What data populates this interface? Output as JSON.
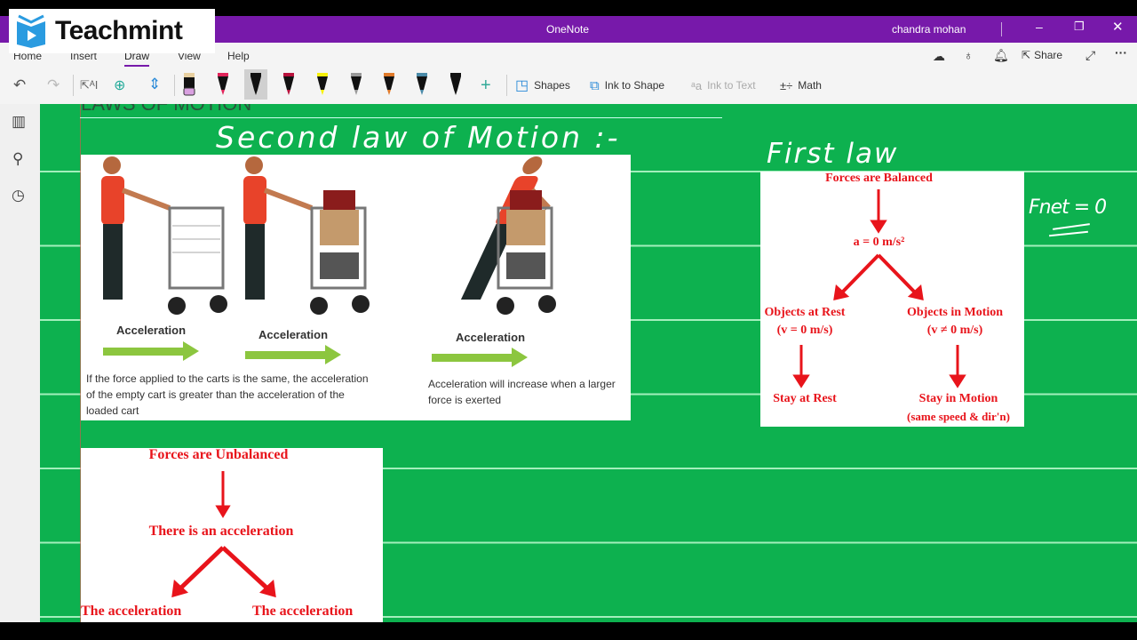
{
  "logo": {
    "text": "Teachmint"
  },
  "titlebar": {
    "app": "OneNote",
    "user": "chandra mohan"
  },
  "ribbon": {
    "tabs": [
      "Home",
      "Insert",
      "Draw",
      "View",
      "Help"
    ],
    "active_tab": "Draw",
    "share": "Share",
    "tools": {
      "shapes": "Shapes",
      "ink_to_shape": "Ink to Shape",
      "ink_to_text": "Ink to Text",
      "math": "Math"
    },
    "pens": [
      {
        "name": "eraser",
        "colors": [
          "#111111",
          "#d9a0e0"
        ]
      },
      {
        "name": "pen-pink",
        "colors": [
          "#e0245a",
          "#111111"
        ]
      },
      {
        "name": "pen-black-selected",
        "colors": [
          "#111111",
          "#ffffff"
        ]
      },
      {
        "name": "pen-crimson",
        "colors": [
          "#b8123c",
          "#111111"
        ]
      },
      {
        "name": "highlighter-yellow",
        "colors": [
          "#f7f00a",
          "#111111"
        ]
      },
      {
        "name": "pencil-gray",
        "colors": [
          "#999999",
          "#111111"
        ]
      },
      {
        "name": "pen-rainbow",
        "colors": [
          "#e07a2a",
          "#111111"
        ]
      },
      {
        "name": "pen-blue-gray",
        "colors": [
          "#4a8aa8",
          "#111111"
        ]
      },
      {
        "name": "pen-black",
        "colors": [
          "#111111",
          "#111111"
        ]
      }
    ]
  },
  "page": {
    "title": "LAWS OF MOTION",
    "handwriting": {
      "second_law": "Second law of Motion :-",
      "first_law": "First law",
      "fnet": "Fnet = 0"
    },
    "image_panel": {
      "label": "Acceleration",
      "caption_left": "If the force applied to the carts is the same, the acceleration of the empty cart is greater than the acceleration of the loaded cart",
      "caption_right": "Acceleration will increase when a larger force is exerted"
    },
    "first_law_diagram": {
      "top": "Forces are Balanced",
      "accel": "a = 0 m/s²",
      "left": "Objects at Rest",
      "left_sub": "(v = 0 m/s)",
      "right": "Objects in Motion",
      "right_sub": "(v ≠ 0 m/s)",
      "left_result": "Stay at Rest",
      "right_result": "Stay in Motion",
      "right_result_sub": "(same speed & dir'n)"
    },
    "second_law_diagram": {
      "top": "Forces are Unbalanced",
      "middle": "There is an acceleration",
      "left": "The acceleration",
      "right": "The acceleration"
    }
  },
  "colors": {
    "accent": "#7719aa",
    "page_bg": "#0db14f",
    "diagram_red": "#e8141b",
    "arrow_green": "#8cc63f",
    "shirt": "#e8432a"
  }
}
